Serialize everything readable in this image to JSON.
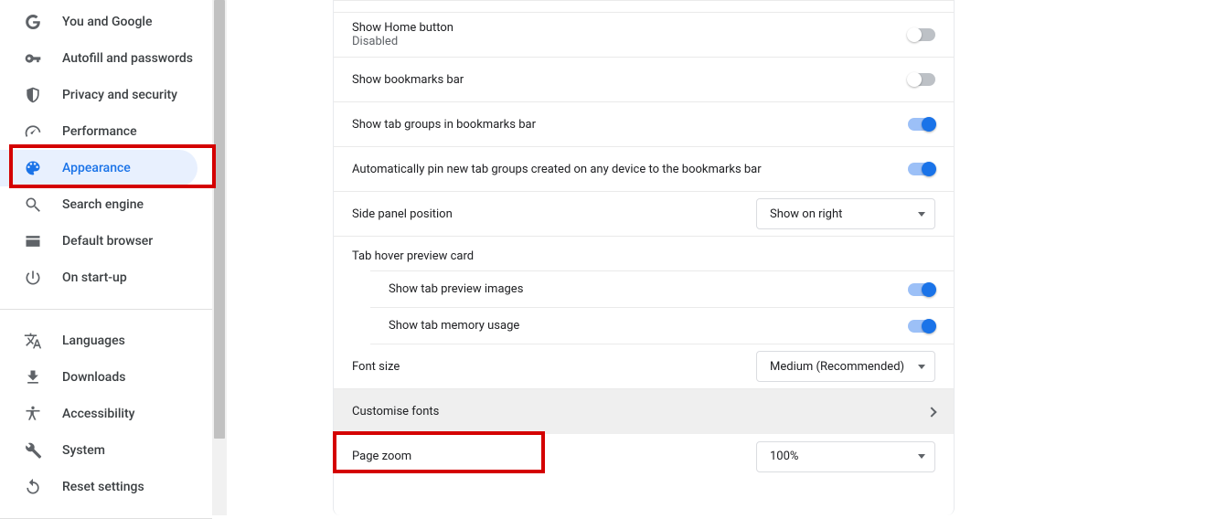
{
  "sidebar": {
    "groups": [
      [
        {
          "icon": "google",
          "label": "You and Google",
          "active": false
        },
        {
          "icon": "key",
          "label": "Autofill and passwords",
          "active": false
        },
        {
          "icon": "shield",
          "label": "Privacy and security",
          "active": false
        },
        {
          "icon": "speed",
          "label": "Performance",
          "active": false
        },
        {
          "icon": "palette",
          "label": "Appearance",
          "active": true
        },
        {
          "icon": "search",
          "label": "Search engine",
          "active": false
        },
        {
          "icon": "browser",
          "label": "Default browser",
          "active": false
        },
        {
          "icon": "power",
          "label": "On start-up",
          "active": false
        }
      ],
      [
        {
          "icon": "language",
          "label": "Languages",
          "active": false
        },
        {
          "icon": "download",
          "label": "Downloads",
          "active": false
        },
        {
          "icon": "accessibility",
          "label": "Accessibility",
          "active": false
        },
        {
          "icon": "wrench",
          "label": "System",
          "active": false
        },
        {
          "icon": "reset",
          "label": "Reset settings",
          "active": false
        }
      ]
    ]
  },
  "settings": {
    "home_button": {
      "title": "Show Home button",
      "sub": "Disabled",
      "on": false
    },
    "bookmarks_bar": {
      "title": "Show bookmarks bar",
      "on": false
    },
    "tab_groups_bm": {
      "title": "Show tab groups in bookmarks bar",
      "on": true
    },
    "auto_pin": {
      "title": "Automatically pin new tab groups created on any device to the bookmarks bar",
      "on": true
    },
    "side_panel": {
      "title": "Side panel position",
      "value": "Show on right"
    },
    "hover_header": "Tab hover preview card",
    "preview_images": {
      "title": "Show tab preview images",
      "on": true
    },
    "memory_usage": {
      "title": "Show tab memory usage",
      "on": true
    },
    "font_size": {
      "title": "Font size",
      "value": "Medium (Recommended)"
    },
    "customise_fonts": {
      "title": "Customise fonts"
    },
    "page_zoom": {
      "title": "Page zoom",
      "value": "100%"
    }
  },
  "colors": {
    "accent": "#1a73e8"
  }
}
